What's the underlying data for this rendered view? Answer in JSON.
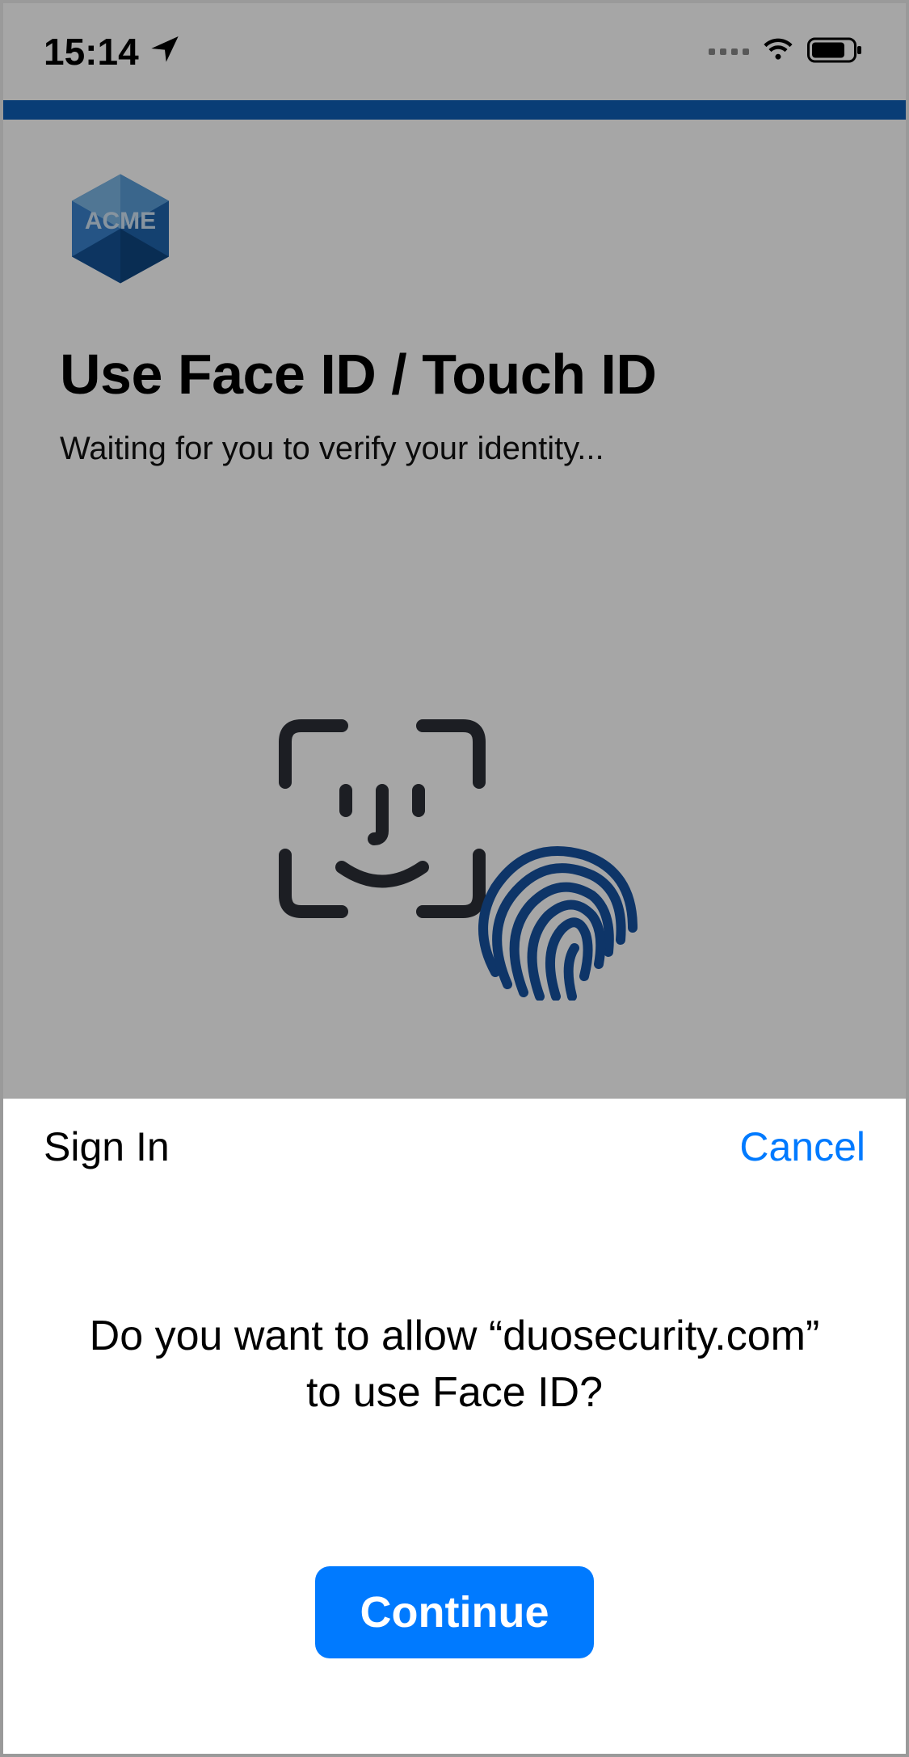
{
  "status_bar": {
    "time": "15:14"
  },
  "page": {
    "logo_text": "ACME",
    "heading": "Use Face ID / Touch ID",
    "subheading": "Waiting for you to verify your identity..."
  },
  "sheet": {
    "title": "Sign In",
    "cancel_label": "Cancel",
    "prompt": "Do you want to allow “duosecurity.com” to use Face ID?",
    "continue_label": "Continue"
  },
  "colors": {
    "accent_blue": "#007aff",
    "bar_blue": "#0f5fb5"
  }
}
